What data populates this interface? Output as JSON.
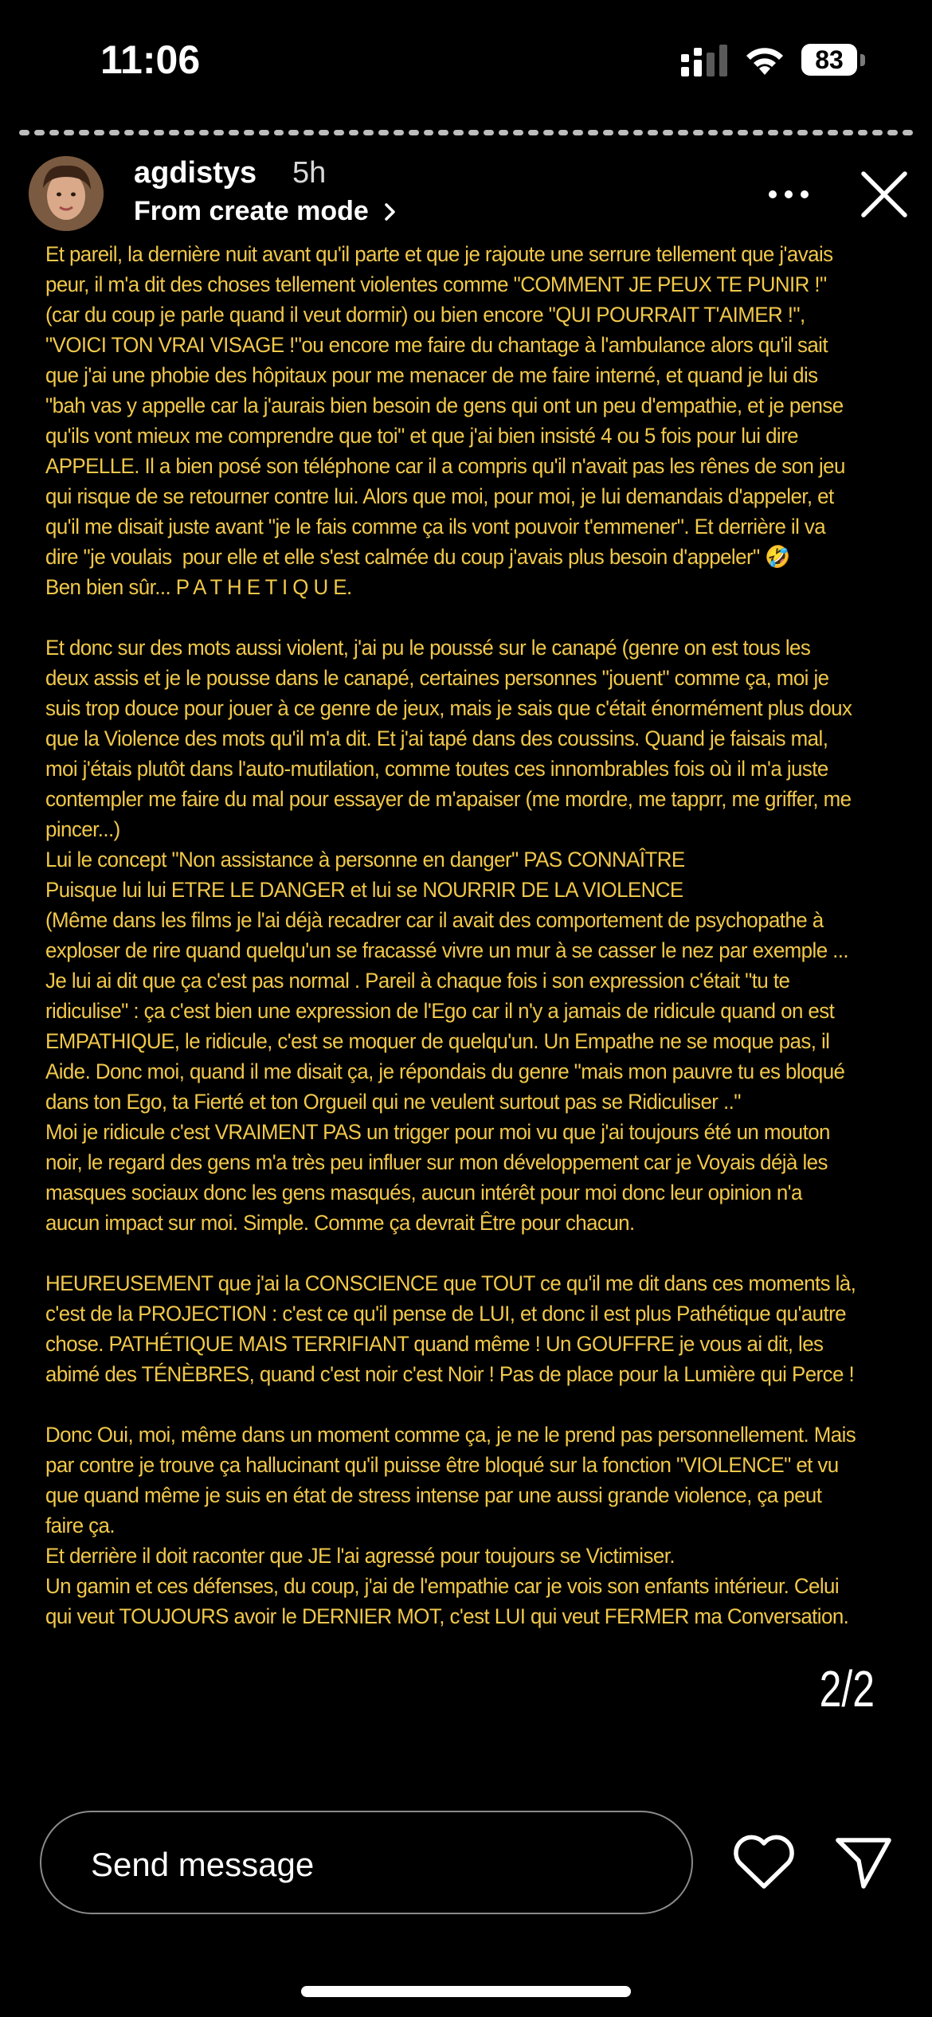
{
  "status_bar": {
    "time": "11:06",
    "battery": "83"
  },
  "header": {
    "username": "agdistys",
    "time_ago": "5h",
    "subtitle": "From create mode"
  },
  "story": {
    "paragraphs": [
      "Et pareil, la dernière nuit avant qu'il parte et que je rajoute une serrure tellement que j'avais peur, il m'a dit des choses tellement violentes comme \"COMMENT JE PEUX TE PUNIR !\" (car du coup je parle quand il veut dormir) ou bien encore \"QUI POURRAIT T'AIMER !\", \"VOICI TON VRAI VISAGE !\"ou encore me faire du chantage à l'ambulance alors qu'il sait que j'ai une phobie des hôpitaux pour me menacer de me faire interné, et quand je lui dis \"bah vas y appelle car la j'aurais bien besoin de gens qui ont un peu d'empathie, et je pense qu'ils vont mieux me comprendre que toi\" et que j'ai bien insisté 4 ou 5 fois pour lui dire APPELLE. Il a bien posé son téléphone car il a compris qu'il n'avait pas les rênes de son jeu qui risque de se retourner contre lui. Alors que moi, pour moi, je lui demandais d'appeler, et qu'il me disait juste avant \"je le fais comme ça ils vont pouvoir t'emmener\". Et derrière il va dire \"je voulais  pour elle et elle s'est calmée du coup j'avais plus besoin d'appeler\" 🤣\nBen bien sûr... P A T H E T I Q U E.",
      "Et donc sur des mots aussi violent, j'ai pu le poussé sur le canapé (genre on est tous les deux assis et je le pousse dans le canapé, certaines personnes \"jouent\" comme ça, moi je suis trop douce pour jouer à ce genre de jeux, mais je sais que c'était énormément plus doux que la Violence des mots qu'il m'a dit. Et j'ai tapé dans des coussins. Quand je faisais mal, moi j'étais plutôt dans l'auto-mutilation, comme toutes ces innombrables fois où il m'a juste contempler me faire du mal pour essayer de m'apaiser (me mordre, me tapprr, me griffer, me pincer...)\nLui le concept \"Non assistance à personne en danger\" PAS CONNAÎTRE\nPuisque lui lui ETRE LE DANGER et lui se NOURRIR DE LA VIOLENCE\n(Même dans les films je l'ai déjà recadrer car il avait des comportement de psychopathe à exploser de rire quand quelqu'un se fracassé vivre un mur à se casser le nez par exemple ... Je lui ai dit que ça c'est pas normal . Pareil à chaque fois i son expression c'était \"tu te ridiculise\" : ça c'est bien une expression de l'Ego car il n'y a jamais de ridicule quand on est EMPATHIQUE, le ridicule, c'est se moquer de quelqu'un. Un Empathe ne se moque pas, il Aide. Donc moi, quand il me disait ça, je répondais du genre \"mais mon pauvre tu es bloqué dans ton Ego, ta Fierté et ton Orgueil qui ne veulent surtout pas se Ridiculiser ..\"\nMoi je ridicule c'est VRAIMENT PAS un trigger pour moi vu que j'ai toujours été un mouton noir, le regard des gens m'a très peu influer sur mon développement car je Voyais déjà les masques sociaux donc les gens masqués, aucun intérêt pour moi donc leur opinion n'a aucun impact sur moi. Simple. Comme ça devrait Être pour chacun.",
      "HEUREUSEMENT que j'ai la CONSCIENCE que TOUT ce qu'il me dit dans ces moments là, c'est de la PROJECTION : c'est ce qu'il pense de LUI, et donc il est plus Pathétique qu'autre chose. PATHÉTIQUE MAIS TERRIFIANT quand même ! Un GOUFFRE je vous ai dit, les abimé des TÉNÈBRES, quand c'est noir c'est Noir ! Pas de place pour la Lumière qui Perce !",
      "Donc Oui, moi, même dans un moment comme ça, je ne le prend pas personnellement. Mais par contre je trouve ça hallucinant qu'il puisse être bloqué sur la fonction \"VIOLENCE\" et vu que quand même je suis en état de stress intense par une aussi grande violence, ça peut faire ça.\nEt derrière il doit raconter que JE l'ai agressé pour toujours se Victimiser.\nUn gamin et ces défenses, du coup, j'ai de l'empathie car je vois son enfants intérieur. Celui qui veut TOUJOURS avoir le DERNIER MOT, c'est LUI qui veut FERMER ma Conversation."
    ],
    "page_counter": "2/2",
    "text_color": "#f1c84a"
  },
  "footer": {
    "message_placeholder": "Send message"
  },
  "icons": [
    "signal-icon",
    "wifi-icon",
    "battery-icon",
    "avatar",
    "more-icon",
    "close-icon",
    "chevron-right-icon",
    "heart-icon",
    "send-icon"
  ]
}
